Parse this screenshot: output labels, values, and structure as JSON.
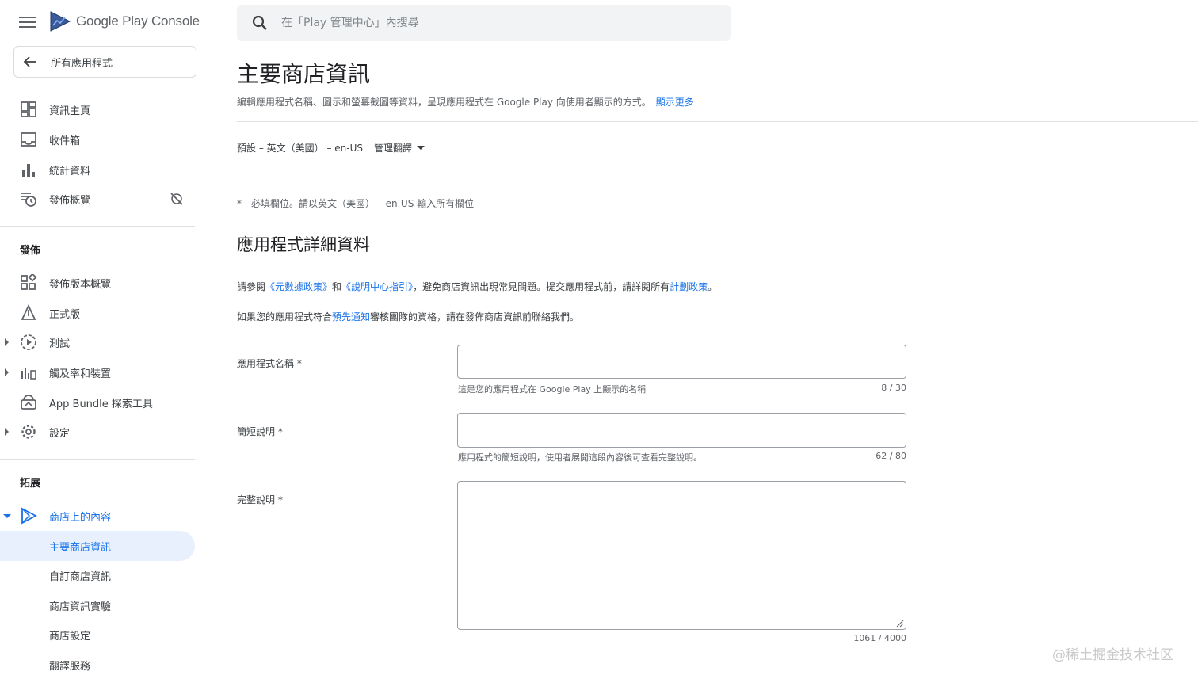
{
  "app": {
    "brand_google": "Google",
    "brand_play": "Play",
    "brand_console": "Console"
  },
  "search": {
    "placeholder": "在「Play 管理中心」內搜尋"
  },
  "sidebar": {
    "back_label": "所有應用程式",
    "items_top": [
      {
        "label": "資訊主頁",
        "icon": "dashboard-icon"
      },
      {
        "label": "收件箱",
        "icon": "inbox-icon"
      },
      {
        "label": "統計資料",
        "icon": "bar-chart-icon"
      },
      {
        "label": "發佈概覽",
        "icon": "publishing-overview-icon"
      }
    ],
    "section_release": "發佈",
    "items_release": [
      {
        "label": "發佈版本概覽",
        "icon": "release-overview-icon"
      },
      {
        "label": "正式版",
        "icon": "production-icon"
      },
      {
        "label": "測試",
        "icon": "testing-icon"
      },
      {
        "label": "觸及率和裝置",
        "icon": "reach-devices-icon"
      },
      {
        "label": "App Bundle 探索工具",
        "icon": "app-bundle-icon"
      },
      {
        "label": "設定",
        "icon": "settings-icon"
      }
    ],
    "section_grow": "拓展",
    "store_presence": "商店上的內容",
    "store_items": [
      {
        "label": "主要商店資訊"
      },
      {
        "label": "自訂商店資訊"
      },
      {
        "label": "商店資訊實驗"
      },
      {
        "label": "商店設定"
      },
      {
        "label": "翻譯服務"
      }
    ]
  },
  "main": {
    "title": "主要商店資訊",
    "description": "編輯應用程式名稱、圖示和螢幕截圖等資料，呈現應用程式在 Google Play 向使用者顯示的方式。",
    "learn_more": "顯示更多",
    "language": "預設 – 英文（美國） – en-US",
    "manage_translations": "管理翻譯",
    "required_note": "* - 必填欄位。請以英文（美國） – en-US 輸入所有欄位",
    "section_title": "應用程式詳細資料",
    "policy": {
      "p1_a": "請參閱",
      "p1_link1": "《元數據政策》",
      "p1_b": "和",
      "p1_link2": "《說明中心指引》",
      "p1_c": "，避免商店資訊出現常見問題。提交應用程式前，請詳閱所有",
      "p1_link3": "計劃政策",
      "p1_d": "。",
      "p2_a": "如果您的應用程式符合",
      "p2_link": "預先通知",
      "p2_b": "審核團隊的資格，請在發佈商店資訊前聯絡我們。"
    },
    "fields": {
      "app_name": {
        "label": "應用程式名稱 *",
        "value": "",
        "helper": "這是您的應用程式在 Google Play 上顯示的名稱",
        "counter": "8 / 30"
      },
      "short_desc": {
        "label": "簡短說明 *",
        "value": "",
        "helper": "應用程式的簡短說明，使用者展開這段內容後可查看完整說明。",
        "counter": "62 / 80"
      },
      "full_desc": {
        "label": "完整說明 *",
        "value": "",
        "counter": "1061 / 4000"
      }
    }
  },
  "watermark": "@稀土掘金技术社区",
  "colors": {
    "accent": "#1a73e8",
    "selected_bg": "#e8f0fe",
    "text": "#202124",
    "muted": "#5f6368"
  }
}
